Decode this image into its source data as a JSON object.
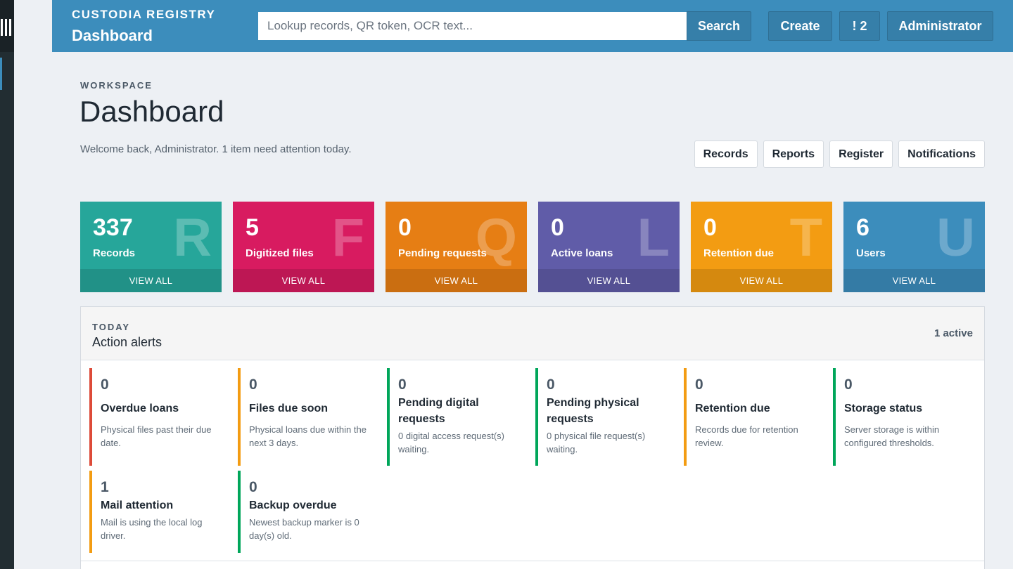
{
  "header": {
    "brand_name": "CUSTODIA REGISTRY",
    "brand_title": "Dashboard",
    "search_placeholder": "Lookup records, QR token, OCR text...",
    "search_label": "Search",
    "create_label": "Create",
    "alerts_label": "! 2",
    "user_label": "Administrator"
  },
  "page": {
    "eyebrow": "WORKSPACE",
    "title": "Dashboard",
    "welcome": "Welcome back, Administrator. 1 item need attention today.",
    "quick_links": [
      "Records",
      "Reports",
      "Register",
      "Notifications"
    ]
  },
  "tiles": [
    {
      "count": "337",
      "label": "Records",
      "letter": "R",
      "footer": "VIEW ALL",
      "color": "#26a69a"
    },
    {
      "count": "5",
      "label": "Digitized files",
      "letter": "F",
      "footer": "VIEW ALL",
      "color": "#d81b60"
    },
    {
      "count": "0",
      "label": "Pending requests",
      "letter": "Q",
      "footer": "VIEW ALL",
      "color": "#e67e14"
    },
    {
      "count": "0",
      "label": "Active loans",
      "letter": "L",
      "footer": "VIEW ALL",
      "color": "#605ca8"
    },
    {
      "count": "0",
      "label": "Retention due",
      "letter": "T",
      "footer": "VIEW ALL",
      "color": "#f39c12"
    },
    {
      "count": "6",
      "label": "Users",
      "letter": "U",
      "footer": "VIEW ALL",
      "color": "#3c8dbc"
    }
  ],
  "alerts_panel": {
    "eyebrow": "TODAY",
    "title": "Action alerts",
    "badge": "1 active",
    "items": [
      {
        "count": "0",
        "title": "Overdue loans",
        "desc": "Physical files past their due date.",
        "color": "#dd4b39"
      },
      {
        "count": "0",
        "title": "Files due soon",
        "desc": "Physical loans due within the next 3 days.",
        "color": "#f39c12"
      },
      {
        "count": "0",
        "title": "Pending digital requests",
        "desc": "0 digital access request(s) waiting.",
        "color": "#00a65a"
      },
      {
        "count": "0",
        "title": "Pending physical requests",
        "desc": "0 physical file request(s) waiting.",
        "color": "#00a65a"
      },
      {
        "count": "0",
        "title": "Retention due",
        "desc": "Records due for retention review.",
        "color": "#f39c12"
      },
      {
        "count": "0",
        "title": "Storage status",
        "desc": "Server storage is within configured thresholds.",
        "color": "#00a65a"
      },
      {
        "count": "1",
        "title": "Mail attention",
        "desc": "Mail is using the local log driver.",
        "color": "#f39c12"
      },
      {
        "count": "0",
        "title": "Backup overdue",
        "desc": "Newest backup marker is 0 day(s) old.",
        "color": "#00a65a"
      }
    ]
  }
}
